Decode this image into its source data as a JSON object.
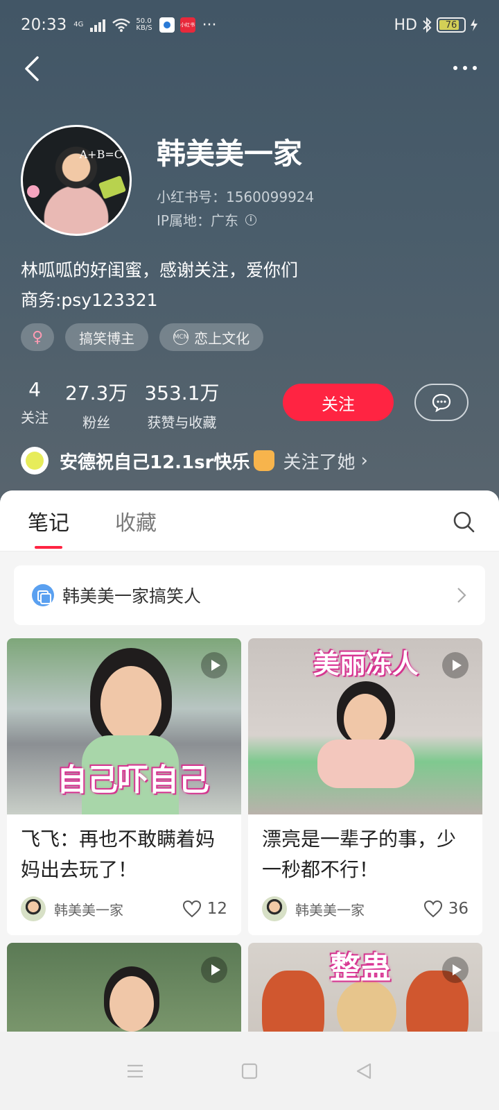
{
  "status_bar": {
    "time": "20:33",
    "network": "4G",
    "speed_top": "50.0",
    "speed_bottom": "KB/S",
    "app2": "小红书",
    "more": "···",
    "hd": "HD",
    "battery": "76"
  },
  "profile": {
    "nickname": "韩美美一家",
    "user_id": "小红书号：1560099924",
    "ip": "IP属地：广东",
    "avatar_chalk": "A+B=C",
    "bio_line1": "林呱呱的好闺蜜，感谢关注，爱你们",
    "bio_line2": "商务:psy123321",
    "tags": [
      "♀",
      "搞笑博主",
      "恋上文化"
    ],
    "mcn_icon": "MCN",
    "stats": [
      {
        "value": "4",
        "label": "关注"
      },
      {
        "value": "27.3万",
        "label": "粉丝"
      },
      {
        "value": "353.1万",
        "label": "获赞与收藏"
      }
    ],
    "follow_label": "关注",
    "friend_name": "安德祝自己12.1sr快乐",
    "friend_action": "关注了她",
    "friend_chevron": "›"
  },
  "tabs": {
    "notes": "笔记",
    "collections": "收藏"
  },
  "collection": {
    "label": "韩美美一家搞笑人",
    "chevron": "›"
  },
  "notes": [
    {
      "title": "飞飞：再也不敢瞒着妈妈出去玩了！",
      "overlay": "自己吓自己",
      "author": "韩美美一家",
      "likes": "12"
    },
    {
      "title": "漂亮是一辈子的事，少一秒都不行！",
      "overlay": "美丽冻人",
      "author": "韩美美一家",
      "likes": "36"
    },
    {
      "title": "",
      "overlay": "",
      "author": "",
      "likes": ""
    },
    {
      "title": "",
      "overlay": "整蛊",
      "author": "",
      "likes": ""
    }
  ],
  "icons": {
    "back": "back-chevron-icon",
    "more": "more-dots-icon",
    "message": "chat-bubble-icon",
    "search": "search-icon",
    "like": "heart-icon",
    "play": "play-icon"
  },
  "colors": {
    "accent": "#ff2442",
    "header_bg": "#4a5d6b"
  }
}
